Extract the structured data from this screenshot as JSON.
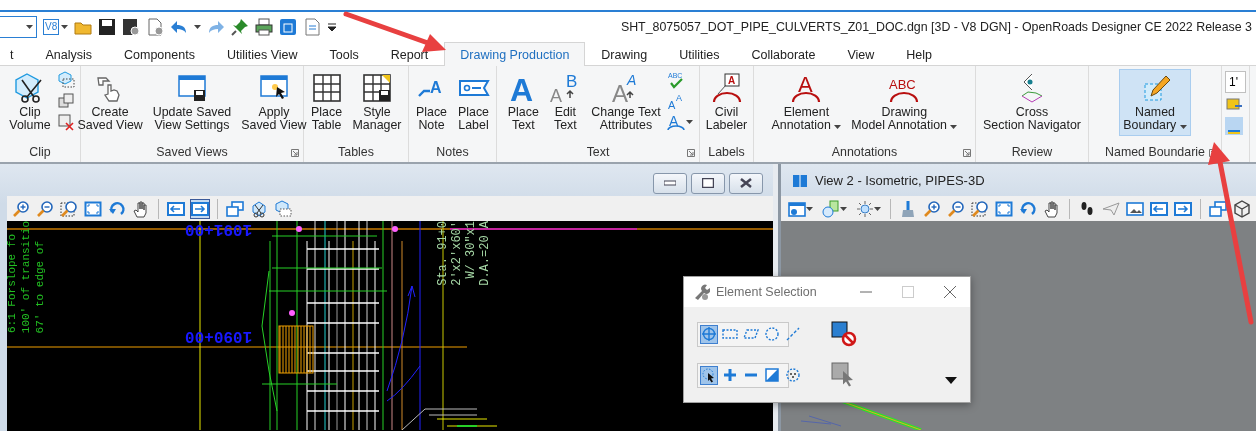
{
  "quick_access": {
    "format_badge": "V8"
  },
  "window": {
    "title": "SHT_8075057_DOT_PIPE_CULVERTS_Z01_DOC.dgn [3D - V8 DGN] - OpenRoads Designer CE 2022 Release 3"
  },
  "tabs": [
    {
      "label": "t",
      "selected": false
    },
    {
      "label": "Analysis",
      "selected": false
    },
    {
      "label": "Components",
      "selected": false
    },
    {
      "label": "Utilities View",
      "selected": false
    },
    {
      "label": "Tools",
      "selected": false
    },
    {
      "label": "Report",
      "selected": false
    },
    {
      "label": "Drawing Production",
      "selected": true
    },
    {
      "label": "Drawing",
      "selected": false
    },
    {
      "label": "Utilities",
      "selected": false
    },
    {
      "label": "Collaborate",
      "selected": false
    },
    {
      "label": "View",
      "selected": false
    },
    {
      "label": "Help",
      "selected": false
    }
  ],
  "ribbon": {
    "groups": [
      {
        "label": "Clip",
        "launcher": false,
        "buttons": [
          {
            "label": "Clip\nVolume",
            "has_menu": false,
            "highlighted": false
          }
        ]
      },
      {
        "label": "Saved Views",
        "launcher": true,
        "buttons": [
          {
            "label": "Create\nSaved View",
            "has_menu": false,
            "highlighted": false
          },
          {
            "label": "Update Saved\nView Settings",
            "has_menu": false,
            "highlighted": false
          },
          {
            "label": "Apply\nSaved View",
            "has_menu": false,
            "highlighted": false
          }
        ]
      },
      {
        "label": "Tables",
        "launcher": false,
        "buttons": [
          {
            "label": "Place\nTable",
            "has_menu": false,
            "highlighted": false
          },
          {
            "label": "Style\nManager",
            "has_menu": false,
            "highlighted": false
          }
        ]
      },
      {
        "label": "Notes",
        "launcher": false,
        "buttons": [
          {
            "label": "Place\nNote",
            "glyphs": [
              "A"
            ],
            "has_menu": false,
            "highlighted": false
          },
          {
            "label": "Place\nLabel",
            "has_menu": false,
            "highlighted": false
          }
        ]
      },
      {
        "label": "Text",
        "launcher": true,
        "buttons": [
          {
            "label": "Place\nText",
            "glyphs": [
              "A"
            ],
            "has_menu": false,
            "highlighted": false
          },
          {
            "label": "Edit\nText",
            "glyphs": [
              "A",
              "B"
            ],
            "has_menu": false,
            "highlighted": false
          },
          {
            "label": "Change Text\nAttributes",
            "glyphs": [
              "A",
              "A"
            ],
            "has_menu": false,
            "highlighted": false
          }
        ],
        "small_tools": [
          {
            "glyphs": [
              "ABC"
            ],
            "has_menu": false
          },
          {
            "glyphs": [
              "A",
              "A"
            ],
            "has_menu": false
          },
          {
            "glyphs": [
              "A"
            ],
            "has_menu": true
          }
        ]
      },
      {
        "label": "Labels",
        "launcher": false,
        "buttons": [
          {
            "label": "Civil\nLabeler",
            "glyphs": [
              "A"
            ],
            "has_menu": false,
            "highlighted": false
          }
        ]
      },
      {
        "label": "Annotations",
        "launcher": true,
        "buttons": [
          {
            "label": "Element\nAnnotation",
            "glyphs": [
              "A"
            ],
            "has_menu": true,
            "highlighted": false
          },
          {
            "label": "Drawing\nModel Annotation",
            "glyphs": [
              "ABC"
            ],
            "has_menu": true,
            "highlighted": false
          }
        ]
      },
      {
        "label": "Review",
        "launcher": false,
        "buttons": [
          {
            "label": "Cross\nSection Navigator",
            "has_menu": false,
            "highlighted": false
          }
        ]
      },
      {
        "label": "Named Boundarie",
        "launcher": true,
        "buttons": [
          {
            "label": "Named\nBoundary",
            "has_menu": true,
            "highlighted": true
          }
        ]
      }
    ],
    "partial_group": {
      "field": "1'"
    }
  },
  "view_1": {
    "toolbar": [
      {
        "pressed": false
      },
      {
        "pressed": false
      },
      {
        "pressed": false
      },
      {
        "pressed": false
      },
      {
        "pressed": false
      },
      {
        "pressed": false
      },
      {
        "pressed": false
      },
      {
        "pressed": true
      },
      {
        "pressed": false
      },
      {
        "pressed": false
      },
      {
        "pressed": false
      }
    ],
    "drawing_labels": [
      {
        "text": "1091+00",
        "kind": "station"
      },
      {
        "text": "1090+00",
        "kind": "station"
      },
      {
        "text": "6:1 Forslope fo",
        "kind": "note"
      },
      {
        "text": "100' of transitio",
        "kind": "note"
      },
      {
        "text": "67' to edge of",
        "kind": "note"
      },
      {
        "text": "Sta. 91+0",
        "kind": "callout"
      },
      {
        "text": "2'x2'x60'",
        "kind": "callout"
      },
      {
        "text": "W/ 30\"x1",
        "kind": "callout"
      },
      {
        "text": "D.A.=20 A",
        "kind": "callout"
      }
    ]
  },
  "view_2": {
    "title": "View 2 - Isometric, PIPES-3D",
    "toolbar": [
      {
        "pressed": false
      },
      {
        "pressed": false
      },
      {
        "pressed": false
      },
      {
        "pressed": false
      },
      {
        "pressed": false
      },
      {
        "pressed": false
      },
      {
        "pressed": false
      },
      {
        "pressed": false
      },
      {
        "pressed": false
      },
      {
        "pressed": false
      },
      {
        "pressed": false
      },
      {
        "pressed": false
      },
      {
        "pressed": false
      },
      {
        "pressed": false
      },
      {
        "pressed": false
      },
      {
        "pressed": false
      },
      {
        "pressed": false
      }
    ]
  },
  "dialog": {
    "title": "Element Selection",
    "methods": [
      {
        "selected": true
      },
      {
        "selected": false
      },
      {
        "selected": false
      },
      {
        "selected": false
      },
      {
        "selected": false
      }
    ],
    "modes": [
      {
        "selected": true
      },
      {
        "selected": false
      },
      {
        "selected": false
      },
      {
        "selected": false
      },
      {
        "selected": false
      }
    ]
  }
}
